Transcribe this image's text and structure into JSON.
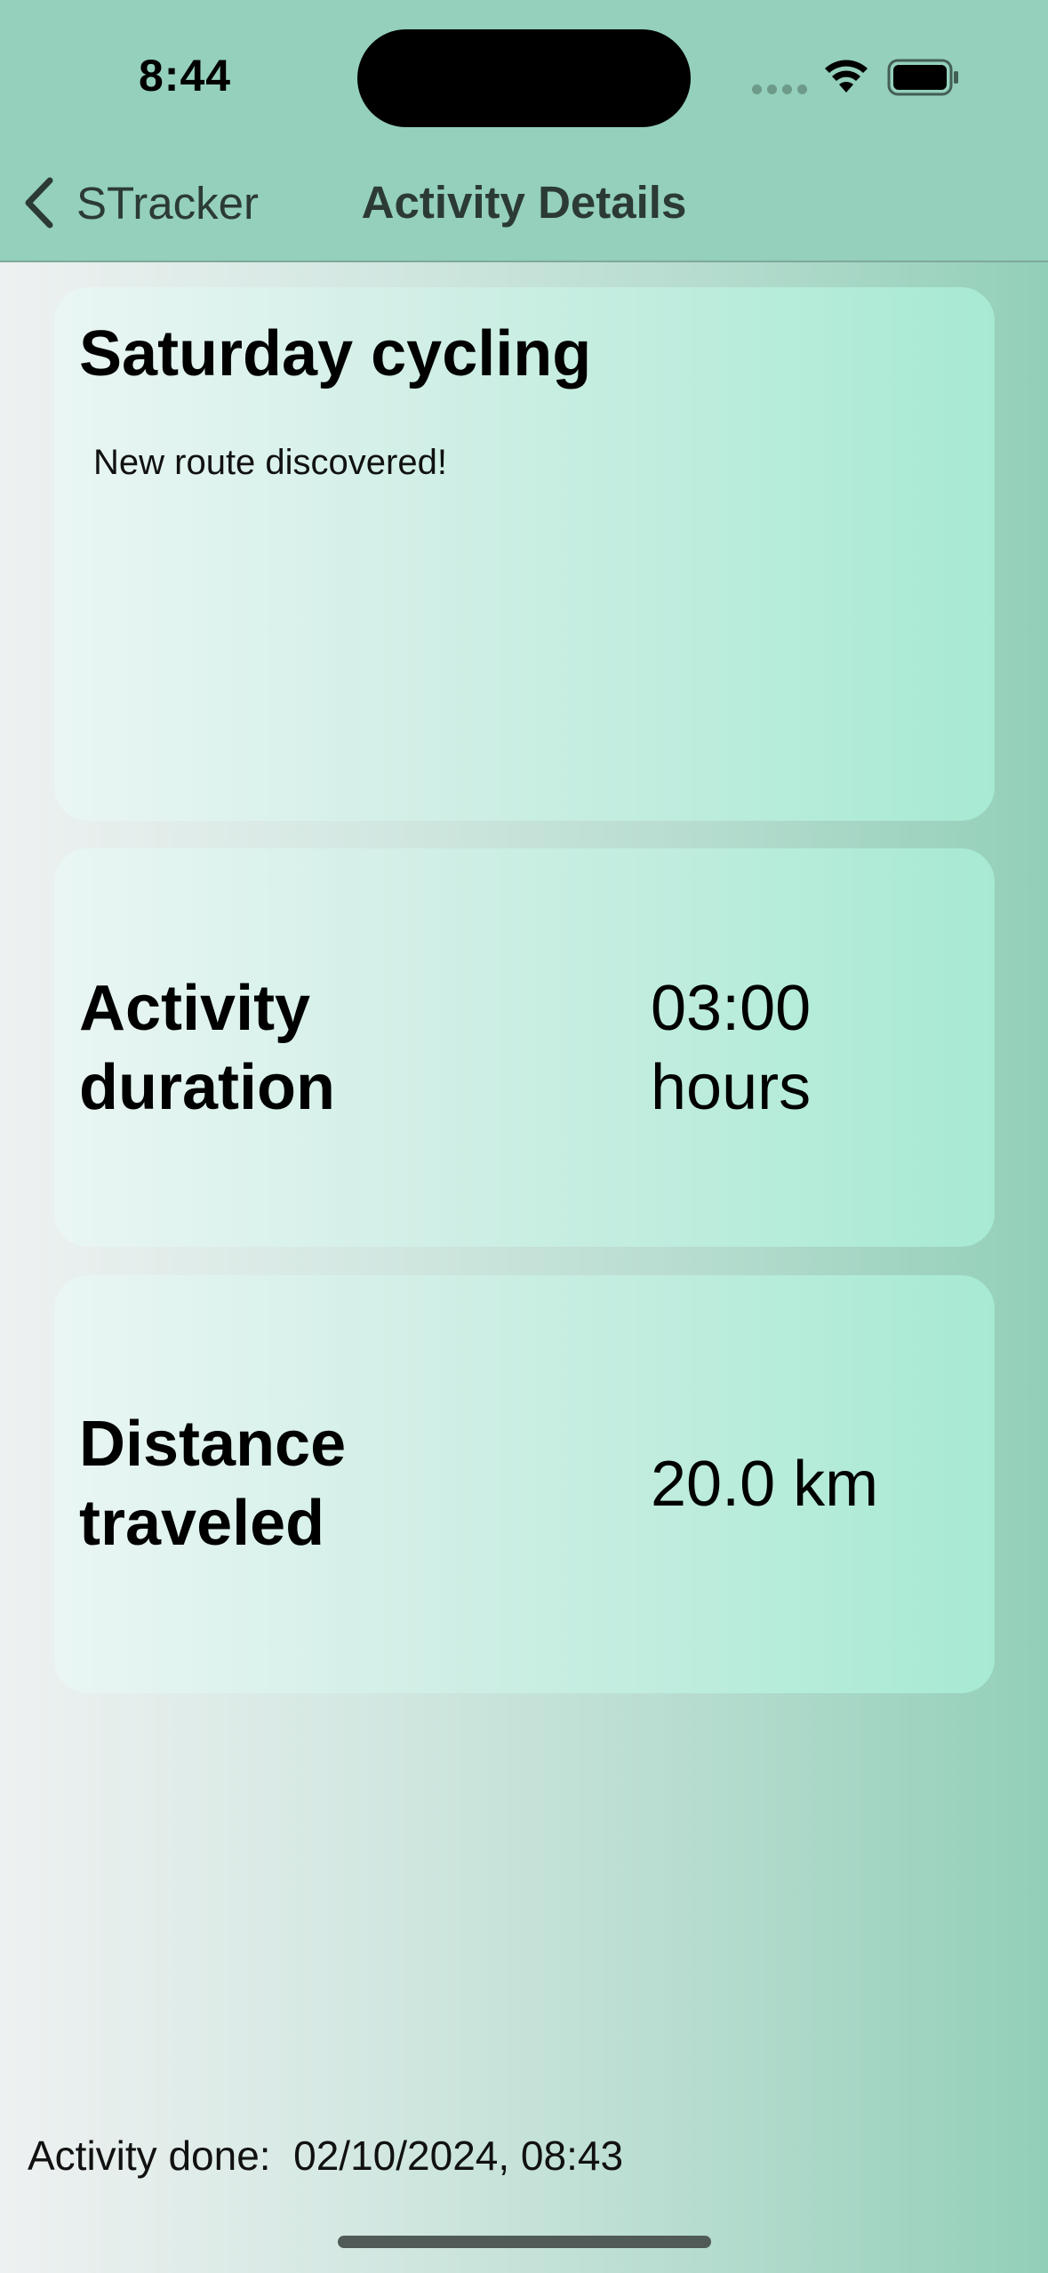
{
  "status_bar": {
    "time": "8:44"
  },
  "nav": {
    "back_label": "STracker",
    "title": "Activity Details"
  },
  "activity": {
    "title": "Saturday cycling",
    "notes": "New route discovered!"
  },
  "stats": {
    "duration_label_line1": "Activity",
    "duration_label_line2": "duration",
    "duration_value_line1": "03:00",
    "duration_value_line2": "hours",
    "distance_label_line1": "Distance",
    "distance_label_line2": "traveled",
    "distance_value": "20.0 km"
  },
  "footer": {
    "label": "Activity done:",
    "datetime": "02/10/2024, 08:43"
  },
  "colors": {
    "nav_background": "#94d0bc",
    "card_accent": "#a7ead3"
  },
  "icons": {
    "back": "chevron-left-icon",
    "wifi": "wifi-icon",
    "battery": "battery-icon",
    "signal": "cellular-signal-icon"
  }
}
